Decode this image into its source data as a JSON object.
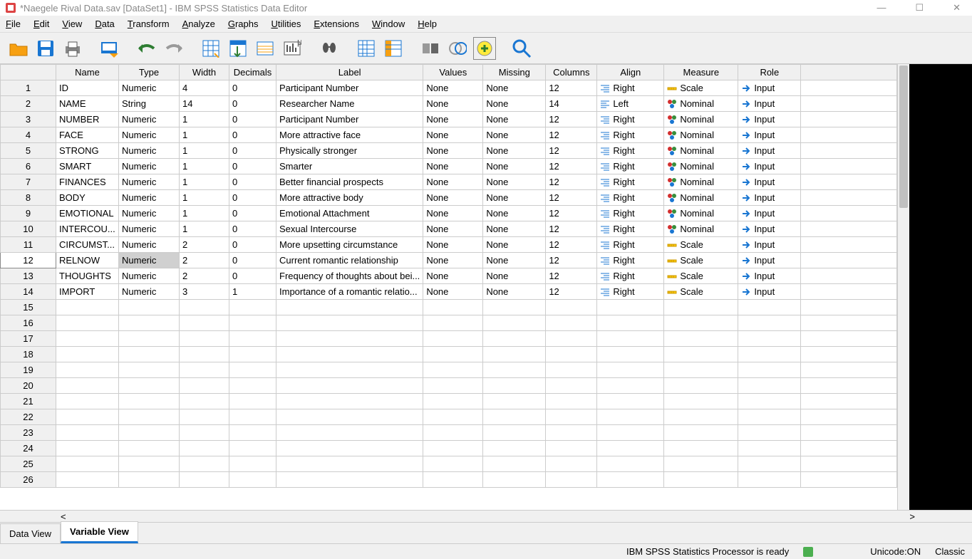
{
  "window": {
    "title": "*Naegele Rival Data.sav [DataSet1] - IBM SPSS Statistics Data Editor"
  },
  "menu": {
    "items": [
      "File",
      "Edit",
      "View",
      "Data",
      "Transform",
      "Analyze",
      "Graphs",
      "Utilities",
      "Extensions",
      "Window",
      "Help"
    ]
  },
  "columns": {
    "rowHeader": "",
    "headers": [
      "Name",
      "Type",
      "Width",
      "Decimals",
      "Label",
      "Values",
      "Missing",
      "Columns",
      "Align",
      "Measure",
      "Role"
    ]
  },
  "selectedRow": 12,
  "selectedCell": {
    "row": 12,
    "col": "type"
  },
  "rows": [
    {
      "n": "1",
      "name": "ID",
      "type": "Numeric",
      "width": "4",
      "decimals": "0",
      "label": "Participant Number",
      "values": "None",
      "missing": "None",
      "columns": "12",
      "align": "Right",
      "measure": "Scale",
      "role": "Input",
      "alignIcon": "right",
      "measureIcon": "scale"
    },
    {
      "n": "2",
      "name": "NAME",
      "type": "String",
      "width": "14",
      "decimals": "0",
      "label": "Researcher Name",
      "values": "None",
      "missing": "None",
      "columns": "14",
      "align": "Left",
      "measure": "Nominal",
      "role": "Input",
      "alignIcon": "left",
      "measureIcon": "nominal"
    },
    {
      "n": "3",
      "name": "NUMBER",
      "type": "Numeric",
      "width": "1",
      "decimals": "0",
      "label": "Participant Number",
      "values": "None",
      "missing": "None",
      "columns": "12",
      "align": "Right",
      "measure": "Nominal",
      "role": "Input",
      "alignIcon": "right",
      "measureIcon": "nominal"
    },
    {
      "n": "4",
      "name": "FACE",
      "type": "Numeric",
      "width": "1",
      "decimals": "0",
      "label": "More attractive face",
      "values": "None",
      "missing": "None",
      "columns": "12",
      "align": "Right",
      "measure": "Nominal",
      "role": "Input",
      "alignIcon": "right",
      "measureIcon": "nominal"
    },
    {
      "n": "5",
      "name": "STRONG",
      "type": "Numeric",
      "width": "1",
      "decimals": "0",
      "label": "Physically stronger",
      "values": "None",
      "missing": "None",
      "columns": "12",
      "align": "Right",
      "measure": "Nominal",
      "role": "Input",
      "alignIcon": "right",
      "measureIcon": "nominal"
    },
    {
      "n": "6",
      "name": "SMART",
      "type": "Numeric",
      "width": "1",
      "decimals": "0",
      "label": "Smarter",
      "values": "None",
      "missing": "None",
      "columns": "12",
      "align": "Right",
      "measure": "Nominal",
      "role": "Input",
      "alignIcon": "right",
      "measureIcon": "nominal"
    },
    {
      "n": "7",
      "name": "FINANCES",
      "type": "Numeric",
      "width": "1",
      "decimals": "0",
      "label": "Better financial prospects",
      "values": "None",
      "missing": "None",
      "columns": "12",
      "align": "Right",
      "measure": "Nominal",
      "role": "Input",
      "alignIcon": "right",
      "measureIcon": "nominal"
    },
    {
      "n": "8",
      "name": "BODY",
      "type": "Numeric",
      "width": "1",
      "decimals": "0",
      "label": "More attractive body",
      "values": "None",
      "missing": "None",
      "columns": "12",
      "align": "Right",
      "measure": "Nominal",
      "role": "Input",
      "alignIcon": "right",
      "measureIcon": "nominal"
    },
    {
      "n": "9",
      "name": "EMOTIONAL",
      "type": "Numeric",
      "width": "1",
      "decimals": "0",
      "label": "Emotional Attachment",
      "values": "None",
      "missing": "None",
      "columns": "12",
      "align": "Right",
      "measure": "Nominal",
      "role": "Input",
      "alignIcon": "right",
      "measureIcon": "nominal"
    },
    {
      "n": "10",
      "name": "INTERCOU...",
      "type": "Numeric",
      "width": "1",
      "decimals": "0",
      "label": "Sexual Intercourse",
      "values": "None",
      "missing": "None",
      "columns": "12",
      "align": "Right",
      "measure": "Nominal",
      "role": "Input",
      "alignIcon": "right",
      "measureIcon": "nominal"
    },
    {
      "n": "11",
      "name": "CIRCUMST...",
      "type": "Numeric",
      "width": "2",
      "decimals": "0",
      "label": "More upsetting circumstance",
      "values": "None",
      "missing": "None",
      "columns": "12",
      "align": "Right",
      "measure": "Scale",
      "role": "Input",
      "alignIcon": "right",
      "measureIcon": "scale"
    },
    {
      "n": "12",
      "name": "RELNOW",
      "type": "Numeric",
      "width": "2",
      "decimals": "0",
      "label": "Current romantic relationship",
      "values": "None",
      "missing": "None",
      "columns": "12",
      "align": "Right",
      "measure": "Scale",
      "role": "Input",
      "alignIcon": "right",
      "measureIcon": "scale"
    },
    {
      "n": "13",
      "name": "THOUGHTS",
      "type": "Numeric",
      "width": "2",
      "decimals": "0",
      "label": "Frequency of thoughts about bei...",
      "values": "None",
      "missing": "None",
      "columns": "12",
      "align": "Right",
      "measure": "Scale",
      "role": "Input",
      "alignIcon": "right",
      "measureIcon": "scale"
    },
    {
      "n": "14",
      "name": "IMPORT",
      "type": "Numeric",
      "width": "3",
      "decimals": "1",
      "label": "Importance of a romantic relatio...",
      "values": "None",
      "missing": "None",
      "columns": "12",
      "align": "Right",
      "measure": "Scale",
      "role": "Input",
      "alignIcon": "right",
      "measureIcon": "scale"
    }
  ],
  "emptyRows": [
    "15",
    "16",
    "17",
    "18",
    "19",
    "20",
    "21",
    "22",
    "23",
    "24",
    "25",
    "26"
  ],
  "tabs": {
    "dataView": "Data View",
    "variableView": "Variable View"
  },
  "status": {
    "processor": "IBM SPSS Statistics Processor is ready",
    "unicode": "Unicode:ON",
    "mode": "Classic"
  }
}
